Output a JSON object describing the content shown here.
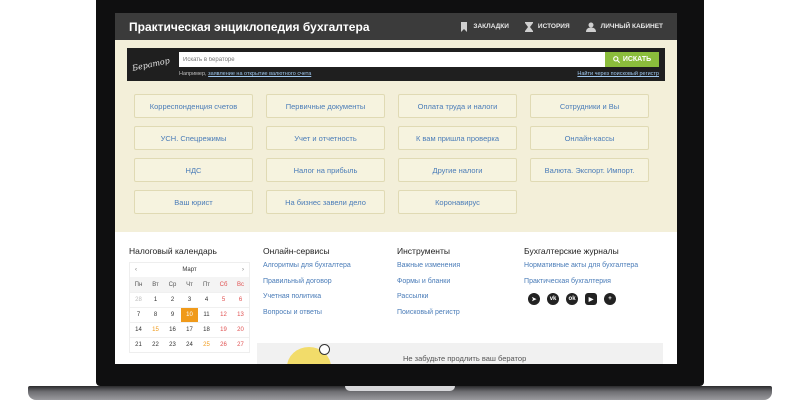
{
  "header": {
    "title": "Практическая энциклопедия бухгалтера",
    "nav": [
      {
        "label": "ЗАКЛАДКИ",
        "icon": "bookmark-icon"
      },
      {
        "label": "ИСТОРИЯ",
        "icon": "hourglass-icon"
      },
      {
        "label": "ЛИЧНЫЙ КАБИНЕТ",
        "icon": "user-icon"
      }
    ]
  },
  "search": {
    "brand": "Бератор",
    "placeholder": "Искать в бераторе",
    "button_label": "ИСКАТЬ",
    "hint_prefix": "Например,",
    "hint_link": "заявление на открытие валютного счета",
    "register_link": "Найти через поисковый регистр"
  },
  "categories": [
    [
      "Корреспонденция счетов",
      "Первичные документы",
      "Оплата труда и налоги",
      "Сотрудники и Вы"
    ],
    [
      "УСН. Спецрежимы",
      "Учет и отчетность",
      "К вам пришла проверка",
      "Онлайн-кассы"
    ],
    [
      "НДС",
      "Налог на прибыль",
      "Другие налоги",
      "Валюта. Экспорт. Импорт."
    ],
    [
      "Ваш юрист",
      "На бизнес завели дело",
      "Коронавирус"
    ]
  ],
  "calendar": {
    "heading": "Налоговый календарь",
    "month": "Март",
    "prev": "‹",
    "next": "›",
    "days_of_week": [
      "Пн",
      "Вт",
      "Ср",
      "Чт",
      "Пт",
      "Сб",
      "Вс"
    ],
    "weeks": [
      [
        "28",
        "1",
        "2",
        "3",
        "4",
        "5",
        "6"
      ],
      [
        "7",
        "8",
        "9",
        "10",
        "11",
        "12",
        "13"
      ],
      [
        "14",
        "15",
        "16",
        "17",
        "18",
        "19",
        "20"
      ],
      [
        "21",
        "22",
        "23",
        "24",
        "25",
        "26",
        "27"
      ]
    ]
  },
  "services": {
    "heading": "Онлайн-сервисы",
    "links": [
      "Алгоритмы для бухгалтера",
      "Правильный договор",
      "Учетная политика",
      "Вопросы и ответы"
    ]
  },
  "tools": {
    "heading": "Инструменты",
    "links": [
      "Важные изменения",
      "Формы и бланки",
      "Рассылки",
      "Поисковый регистр"
    ]
  },
  "journals": {
    "heading": "Бухгалтерские журналы",
    "links": [
      "Нормативные акты для бухгалтера",
      "Практическая бухгалтерия"
    ],
    "socials": [
      {
        "icon": "telegram-icon",
        "glyph": "➤"
      },
      {
        "icon": "vk-icon",
        "glyph": "vk"
      },
      {
        "icon": "odnoklassniki-icon",
        "glyph": "ok"
      },
      {
        "icon": "youtube-icon",
        "glyph": "▶"
      },
      {
        "icon": "plus-icon",
        "glyph": "+"
      }
    ]
  },
  "promo": {
    "text": "Не забудьте продлить ваш бератор"
  },
  "colors": {
    "accent_green": "#8bbd3c",
    "today_orange": "#f09a1a",
    "link_blue": "#4a7cb8",
    "header_dark": "#3b3b3b"
  }
}
